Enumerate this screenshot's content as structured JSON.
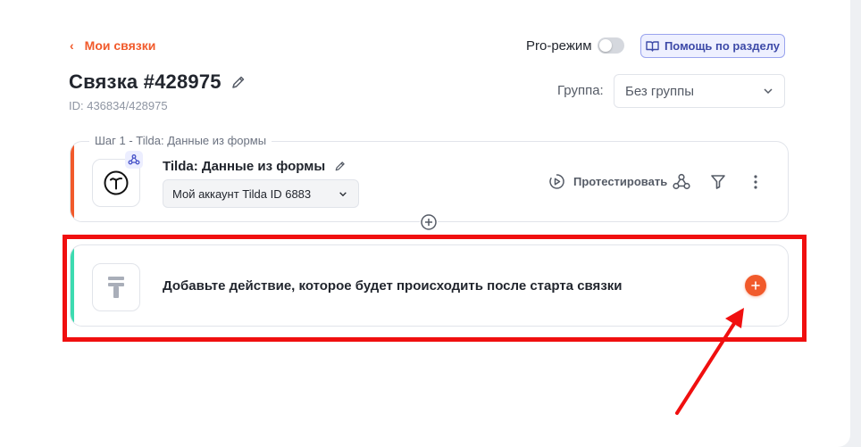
{
  "header": {
    "back_label": "Мои связки",
    "pro_mode_label": "Pro-режим",
    "pro_mode_on": false,
    "help_label": "Помощь по разделу"
  },
  "bundle": {
    "title": "Связка #428975",
    "id_text": "ID: 436834/428975",
    "group_label": "Группа:",
    "group_value": "Без группы"
  },
  "step1": {
    "legend": "Шаг 1 - Tilda: Данные из формы",
    "name": "Tilda: Данные из формы",
    "account": "Мой аккаунт Tilda ID 6883",
    "test_label": "Протестировать"
  },
  "action_step": {
    "prompt": "Добавьте действие, которое будет происходить после старта связки"
  },
  "colors": {
    "accent": "#f15a2b",
    "accent_green": "#3ddbb0",
    "annotation": "#f00f0f"
  },
  "icons": [
    "chevron-left-icon",
    "book-icon",
    "pencil-icon",
    "chevron-down-icon",
    "tilda-logo-icon",
    "webhook-icon",
    "play-icon",
    "filter-icon",
    "more-vertical-icon",
    "plus-icon",
    "app-placeholder-icon"
  ]
}
